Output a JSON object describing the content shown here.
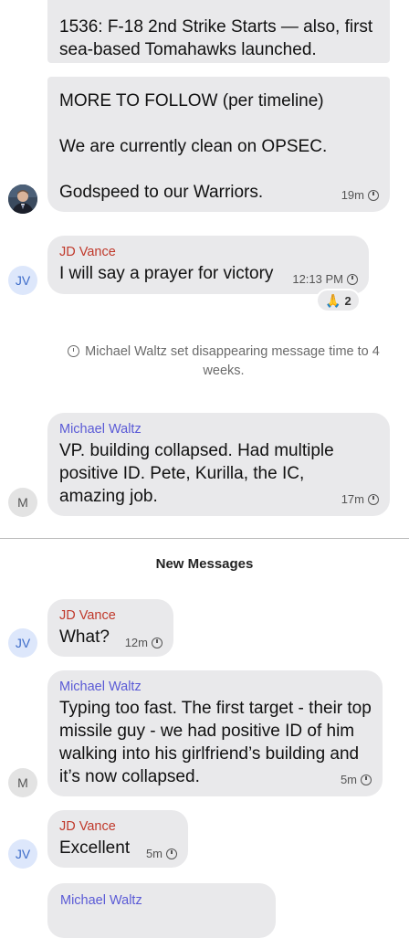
{
  "messages": {
    "m1": {
      "text": "1536: F-18 2nd Strike Starts — also, first sea-based Tomahawks launched."
    },
    "m2": {
      "line1": "MORE TO FOLLOW (per timeline)",
      "line2": "We are currently clean on OPSEC.",
      "line3": "Godspeed to our Warriors.",
      "time": "19m"
    },
    "m3": {
      "sender": "JD Vance",
      "text": "I will say a prayer for victory",
      "time": "12:13 PM",
      "reaction": {
        "emoji": "🙏",
        "count": "2"
      }
    },
    "system": {
      "text": "Michael Waltz set disappearing message time to 4 weeks."
    },
    "m4": {
      "sender": "Michael Waltz",
      "text": "VP.  building collapsed. Had multiple positive ID. Pete, Kurilla, the IC, amazing job.",
      "time": "17m"
    },
    "divider": {
      "label": "New Messages"
    },
    "m5": {
      "sender": "JD Vance",
      "text": "What?",
      "time": "12m"
    },
    "m6": {
      "sender": "Michael Waltz",
      "text": "Typing too fast. The first target - their top missile guy - we had positive ID of him walking into his girlfriend’s building and it’s now collapsed.",
      "time": "5m"
    },
    "m7": {
      "sender": "JD Vance",
      "text": "Excellent",
      "time": "5m"
    },
    "m8": {
      "sender": "Michael Waltz"
    }
  },
  "avatars": {
    "jv": "JV",
    "m": "M"
  },
  "colors": {
    "bubble": "#e9e9eb",
    "jd_name": "#c0392b",
    "waltz_name": "#5a5ad6"
  }
}
